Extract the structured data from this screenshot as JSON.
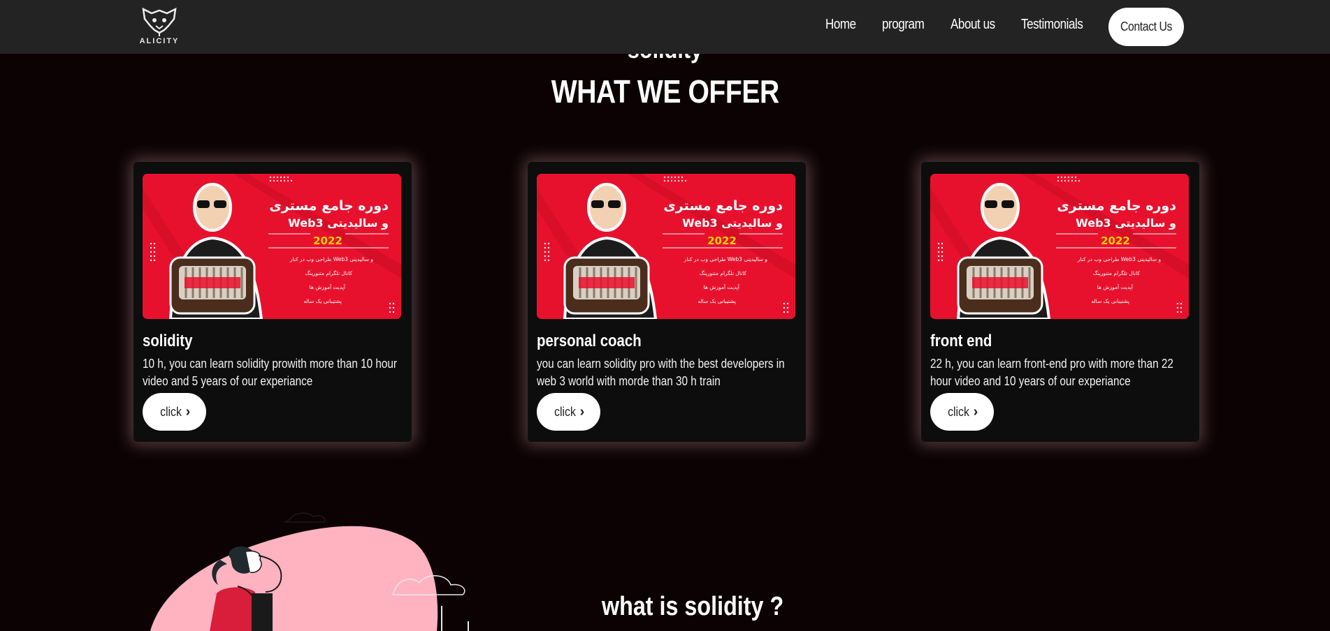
{
  "brand": {
    "logo_text": "ALICITY"
  },
  "nav": {
    "links": [
      "Home",
      "program",
      "About us",
      "Testimonials"
    ],
    "contact_label": "Contact Us"
  },
  "sections": {
    "previous_title": "solidity",
    "offer_title": "WHAT WE OFFER",
    "bottom_title": "what is solidity ?"
  },
  "cards": [
    {
      "title": "solidity",
      "description": "10 h, you can learn solidity prowith more than 10 hour video and 5 years of our experiance",
      "button_label": "click"
    },
    {
      "title": "personal coach",
      "description": "you can learn solidity pro with the best developers in web 3 world with morde than 30 h train",
      "button_label": "click"
    },
    {
      "title": "front end",
      "description": "22 h, you can learn front-end pro with more than 22 hour video and 10 years of our experiance",
      "button_label": "click"
    }
  ],
  "course_banner": {
    "title_line1": "دوره جامع مستری",
    "title_line2": "Web3 و سالیدیتی",
    "year": "2022",
    "features": [
      "طراحی وب در کنار Web3 و سالیدیتی",
      "کانال تلگرام متنورینگ",
      "آپدیت آموزش ها",
      "پشتیبانی یک ساله"
    ],
    "colors": {
      "background": "#e8112d",
      "text": "#ffffff",
      "year_accent": "#ffd200"
    }
  },
  "colors": {
    "page_background": "#0c0204",
    "navbar": "#232323",
    "card": "#0d0d0d",
    "blob": "#ffb3c1"
  }
}
